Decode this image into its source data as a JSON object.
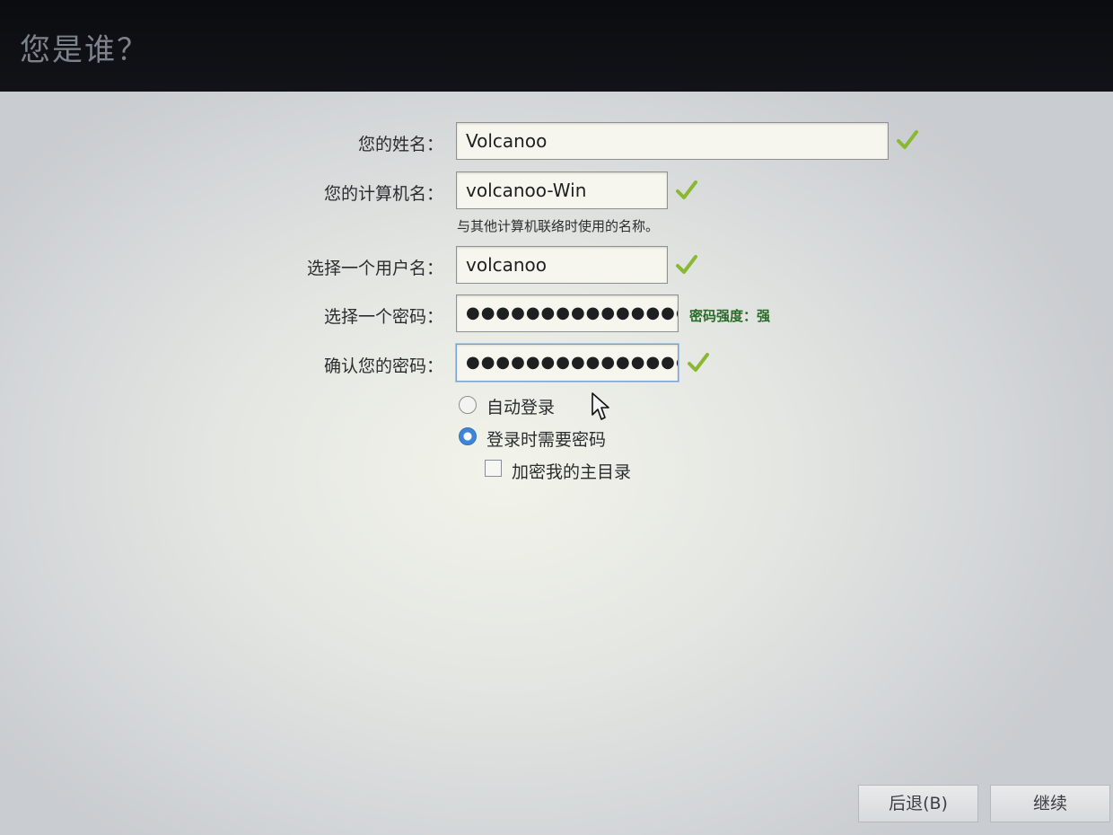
{
  "header": {
    "title": "您是谁？"
  },
  "form": {
    "name_label": "您的姓名：",
    "name_value": "Volcanoo",
    "computer_label": "您的计算机名：",
    "computer_value": "volcanoo-Win",
    "computer_hint": "与其他计算机联络时使用的名称。",
    "username_label": "选择一个用户名：",
    "username_value": "volcanoo",
    "password_label": "选择一个密码：",
    "password_value": "●●●●●●●●●●●●●●●",
    "password_strength": "密码强度：强",
    "confirm_label": "确认您的密码：",
    "confirm_value": "●●●●●●●●●●●●●●●"
  },
  "options": {
    "auto_login": "自动登录",
    "require_password": "登录时需要密码",
    "encrypt_home": "加密我的主目录",
    "selected": "require_password",
    "encrypt_checked": false
  },
  "buttons": {
    "back": "后退(B)",
    "continue": "继续"
  },
  "colors": {
    "check": "#8ab832",
    "strength": "#2a6b2a",
    "radio_selected": "#3d85d6"
  }
}
